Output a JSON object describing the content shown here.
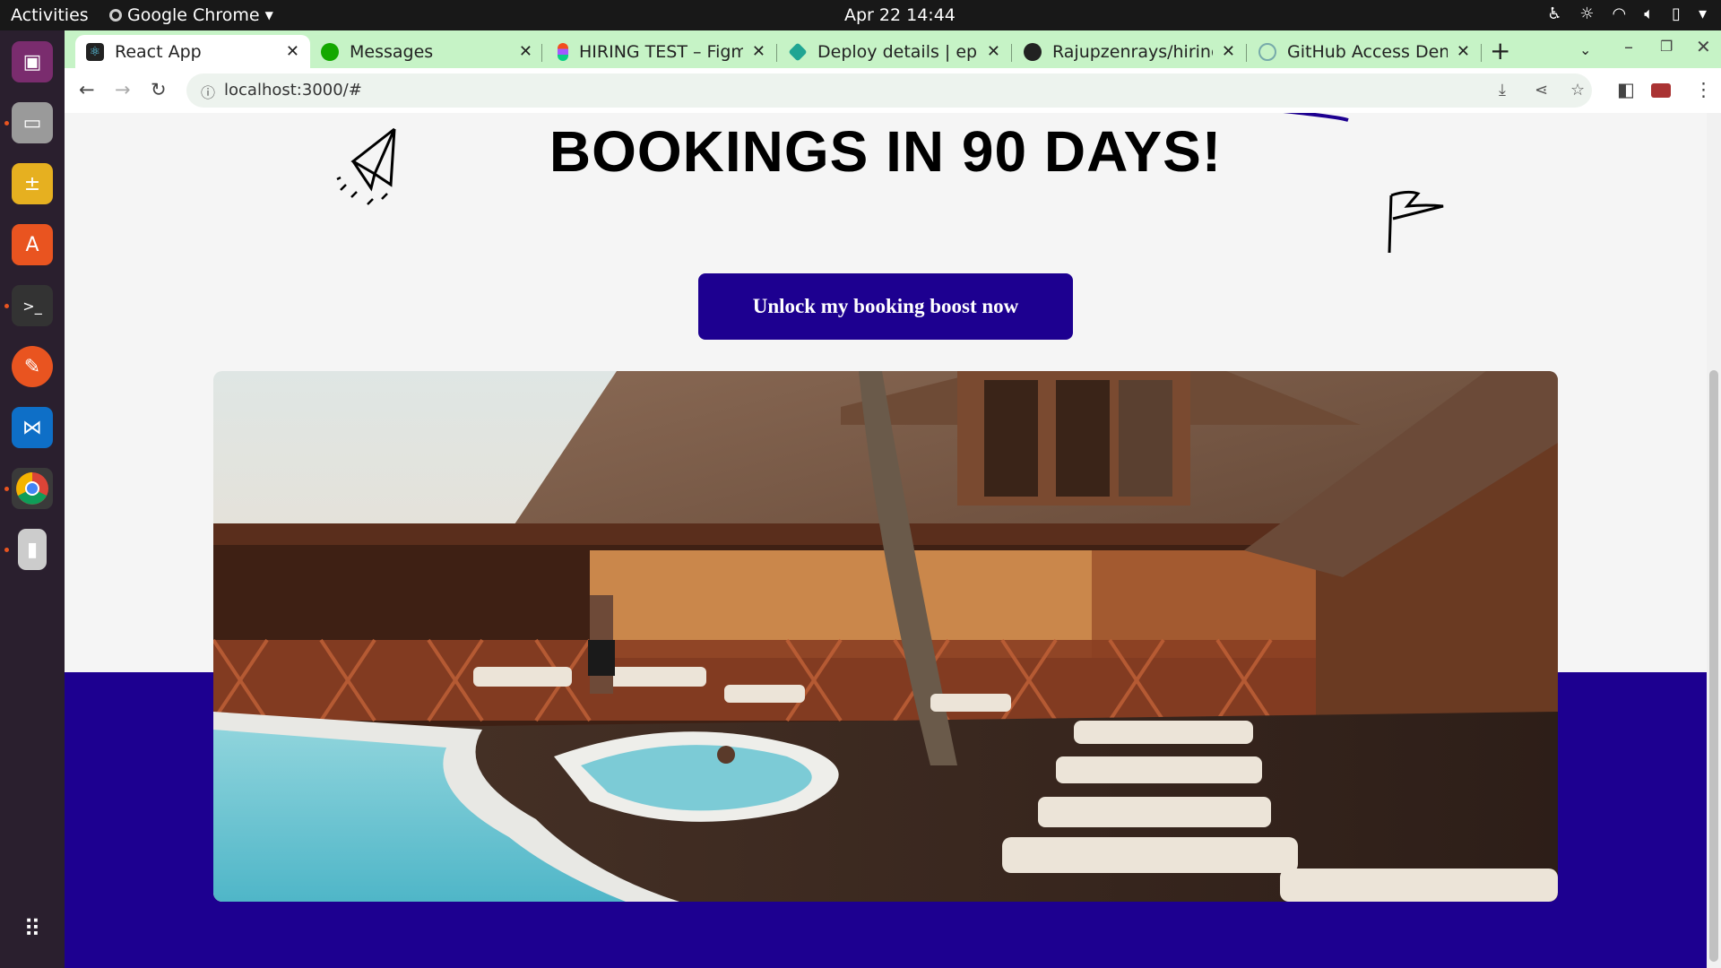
{
  "topbar": {
    "activities": "Activities",
    "app_name": "Google Chrome",
    "clock": "Apr 22  14:44"
  },
  "dock": {
    "items": [
      "video-editor",
      "files",
      "calculator",
      "app-center",
      "terminal",
      "draw",
      "vscode",
      "chrome",
      "archive"
    ],
    "show_apps_icon": "grid-icon"
  },
  "tabs": [
    {
      "title": "React App",
      "active": true,
      "favicon": "react-icon"
    },
    {
      "title": "Messages",
      "active": false,
      "favicon": "upwork-icon"
    },
    {
      "title": "HIRING TEST – Figma",
      "active": false,
      "favicon": "figma-icon"
    },
    {
      "title": "Deploy details | ephe",
      "active": false,
      "favicon": "netlify-icon"
    },
    {
      "title": "Rajupzenrays/hiring-t",
      "active": false,
      "favicon": "github-icon"
    },
    {
      "title": "GitHub Access Denie",
      "active": false,
      "favicon": "openai-icon"
    }
  ],
  "toolbar": {
    "url": "localhost:3000/#"
  },
  "page": {
    "headline": "BOOKINGS IN 90 DAYS!",
    "cta_label": "Unlock my booking boost now",
    "hero_image": "resort-pool-deck-photo"
  },
  "colors": {
    "brand_blue": "#1d0090",
    "tab_strip": "#c6f3c6",
    "page_bg": "#f5f5f5"
  }
}
